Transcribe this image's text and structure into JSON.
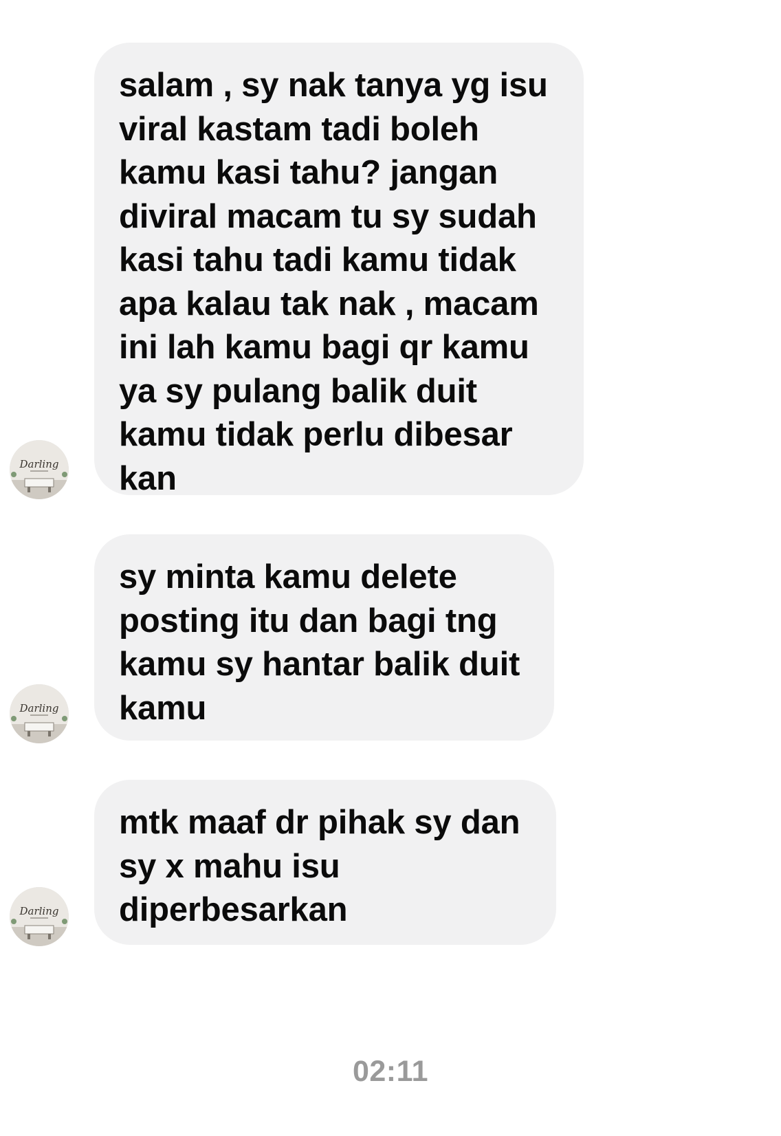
{
  "conversation": {
    "messages": [
      {
        "text": "salam ,  sy nak tanya yg isu\nviral kastam tadi boleh\nkamu kasi tahu? jangan\ndiviral macam tu sy sudah\nkasi tahu tadi kamu tidak\napa kalau tak nak , macam\nini lah kamu bagi qr kamu\nya sy pulang balik duit\nkamu tidak perlu dibesar\nkan",
        "avatar_icon": "darling-logo-avatar-icon",
        "avatar_text": "Darling"
      },
      {
        "text": "sy minta kamu delete\nposting itu dan bagi tng\nkamu sy hantar balik duit\nkamu",
        "avatar_icon": "darling-logo-avatar-icon",
        "avatar_text": "Darling"
      },
      {
        "text": "mtk maaf dr pihak sy dan\nsy x mahu isu\ndiperbesarkan",
        "avatar_icon": "darling-logo-avatar-icon",
        "avatar_text": "Darling"
      }
    ],
    "timestamp": "02:11"
  },
  "colors": {
    "bubble_bg": "#f1f1f2",
    "text": "#0b0b0b",
    "timestamp": "#9a9a9a"
  }
}
